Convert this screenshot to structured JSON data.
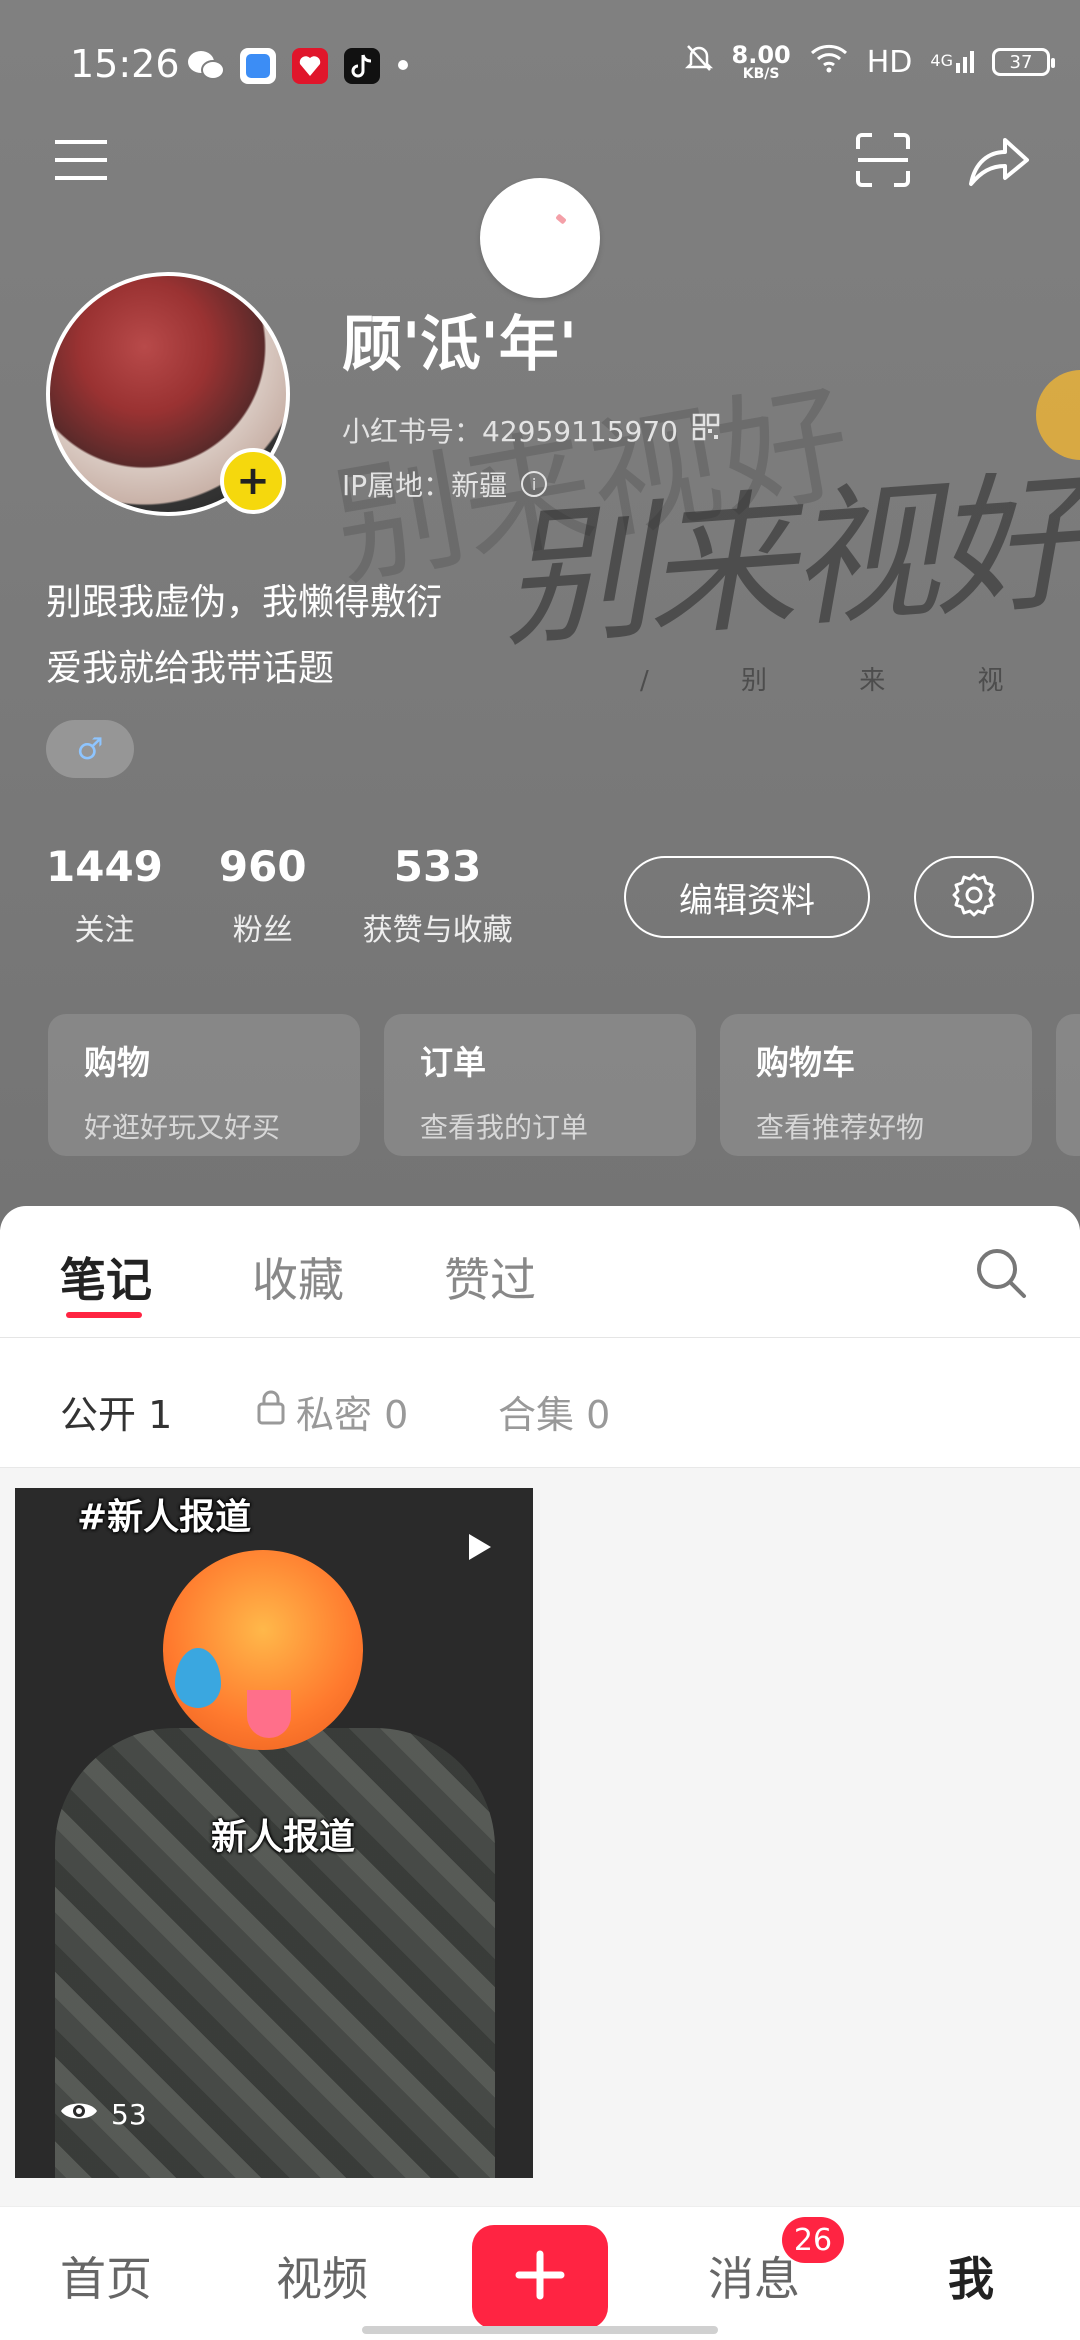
{
  "status_bar": {
    "time": "15:26",
    "net_speed_value": "8.00",
    "net_speed_unit": "KB/S",
    "hd": "HD",
    "network": "4G",
    "battery": "37"
  },
  "profile": {
    "name": "顾'泜'年'",
    "red_id": "小红书号：42959115970",
    "ip_location": "IP属地：新疆",
    "bio_line1": "别跟我虚伪，我懒得敷衍",
    "bio_line2": "爱我就给我带话题",
    "gender_symbol": "♂",
    "avatar_add_symbol": "+",
    "background_art": "别来视好",
    "background_art_sub": "/ 别 来 视 奸 我 了"
  },
  "stats": [
    {
      "value": "1449",
      "label": "关注"
    },
    {
      "value": "960",
      "label": "粉丝"
    },
    {
      "value": "533",
      "label": "获赞与收藏"
    }
  ],
  "actions": {
    "edit_profile": "编辑资料"
  },
  "cards": [
    {
      "title": "购物",
      "subtitle": "好逛好玩又好买"
    },
    {
      "title": "订单",
      "subtitle": "查看我的订单"
    },
    {
      "title": "购物车",
      "subtitle": "查看推荐好物"
    }
  ],
  "tabs": [
    {
      "label": "笔记",
      "active": true
    },
    {
      "label": "收藏",
      "active": false
    },
    {
      "label": "赞过",
      "active": false
    }
  ],
  "subtabs": [
    {
      "label": "公开 1"
    },
    {
      "label": "私密 0"
    },
    {
      "label": "合集 0"
    }
  ],
  "note": {
    "sticker_top": "#新人报道",
    "sticker_mid": "新人报道",
    "views": "53"
  },
  "bottom_nav": {
    "home": "首页",
    "video": "视频",
    "messages": "消息",
    "messages_badge": "26",
    "me": "我"
  },
  "colors": {
    "accent": "#ff2442",
    "avatar_add": "#f5d80d",
    "header_bg": "#7b7b7b"
  }
}
